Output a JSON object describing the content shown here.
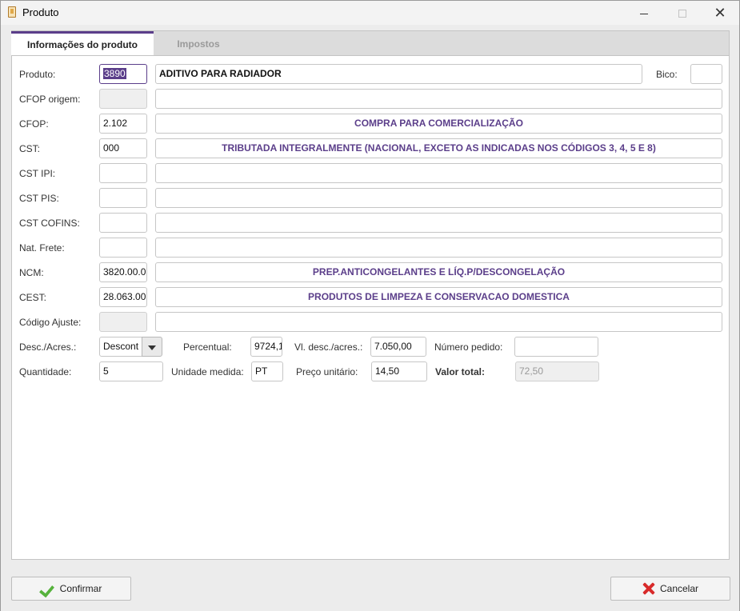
{
  "window": {
    "title": "Produto"
  },
  "tabs": [
    {
      "label": "Informações do produto"
    },
    {
      "label": "Impostos"
    }
  ],
  "form": {
    "produto": {
      "label": "Produto:",
      "code": "3890",
      "description": "ADITIVO PARA RADIADOR"
    },
    "bico": {
      "label": "Bico:",
      "value": ""
    },
    "cfop_origem": {
      "label": "CFOP origem:",
      "code": "",
      "description": ""
    },
    "cfop": {
      "label": "CFOP:",
      "code": "2.102",
      "description": "COMPRA PARA COMERCIALIZAÇÃO"
    },
    "cst": {
      "label": "CST:",
      "code": "000",
      "description": "TRIBUTADA INTEGRALMENTE (NACIONAL, EXCETO AS INDICADAS NOS CÓDIGOS 3, 4, 5 E 8)"
    },
    "cst_ipi": {
      "label": "CST IPI:",
      "code": "",
      "description": ""
    },
    "cst_pis": {
      "label": "CST PIS:",
      "code": "",
      "description": ""
    },
    "cst_cofins": {
      "label": "CST COFINS:",
      "code": "",
      "description": ""
    },
    "nat_frete": {
      "label": "Nat. Frete:",
      "code": "",
      "description": ""
    },
    "ncm": {
      "label": "NCM:",
      "code": "3820.00.0(",
      "description": "PREP.ANTICONGELANTES E LÍQ.P/DESCONGELAÇÃO"
    },
    "cest": {
      "label": "CEST:",
      "code": "28.063.00",
      "description": "PRODUTOS DE LIMPEZA E CONSERVACAO DOMESTICA"
    },
    "codigo_ajuste": {
      "label": "Código Ajuste:",
      "code": "",
      "description": ""
    },
    "desc_acres": {
      "label": "Desc./Acres.:",
      "value": "Descont"
    },
    "percentual": {
      "label": "Percentual:",
      "value": "9724,1"
    },
    "vl_desc_acres": {
      "label": "Vl. desc./acres.:",
      "value": "7.050,00"
    },
    "numero_pedido": {
      "label": "Número pedido:",
      "value": ""
    },
    "quantidade": {
      "label": "Quantidade:",
      "value": "5"
    },
    "unidade_medida": {
      "label": "Unidade medida:",
      "value": "PT"
    },
    "preco_unitario": {
      "label": "Preço unitário:",
      "value": "14,50"
    },
    "valor_total": {
      "label": "Valor total:",
      "value": "72,50"
    }
  },
  "buttons": {
    "confirm": "Confirmar",
    "cancel": "Cancelar"
  },
  "icons": {
    "confirm": "check-icon",
    "cancel": "x-icon"
  },
  "colors": {
    "accent": "#5b3e8a",
    "confirm_icon": "#56b23c",
    "cancel_icon": "#d82a2a"
  }
}
